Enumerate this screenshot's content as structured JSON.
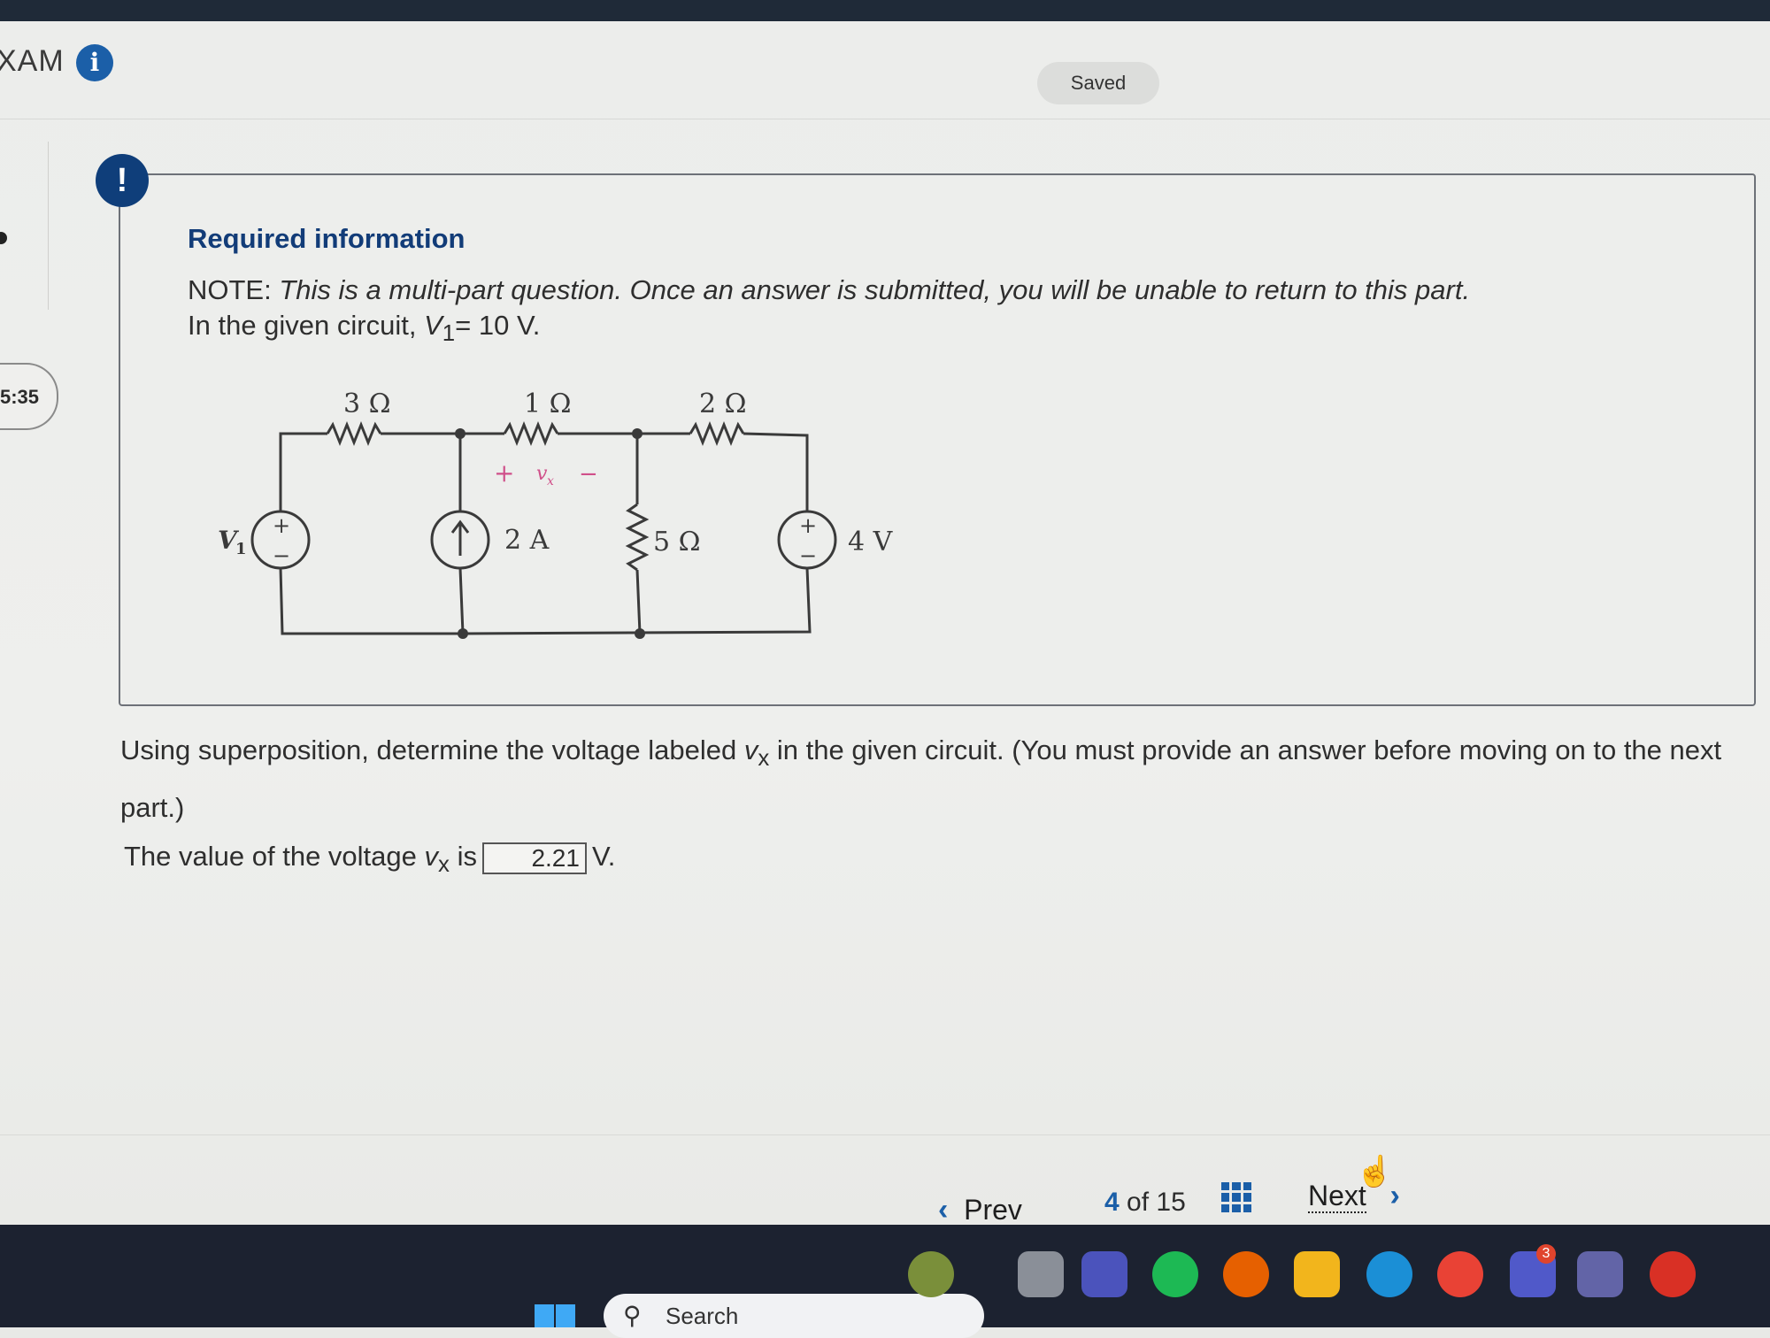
{
  "header": {
    "title": "XAM",
    "info_icon": "info-icon",
    "saved_label": "Saved"
  },
  "sidebar": {
    "timer": "5:35"
  },
  "required": {
    "title": "Required information",
    "note_prefix": "NOTE:",
    "note_italic": "This is a multi-part question. Once an answer is submitted, you will be unable to return to this part.",
    "given_prefix": "In the given circuit,",
    "given_var": "V",
    "given_sub": "1",
    "given_value": "= 10 V."
  },
  "circuit": {
    "r1": "3 Ω",
    "r2": "1 Ω",
    "r3": "2 Ω",
    "r4": "5 Ω",
    "i_source": "2 A",
    "v_source2": "4 V",
    "v_source1": "V",
    "v_source1_sub": "1",
    "vx_label": "v",
    "vx_sub": "x",
    "plus": "+",
    "minus": "−"
  },
  "question": {
    "text_a": "Using superposition, determine the voltage labeled",
    "var": "v",
    "var_sub": "x",
    "text_b": "in the given circuit. (You must provide an answer before moving on to the next part.)"
  },
  "answer": {
    "label_a": "The value of the voltage",
    "var": "v",
    "var_sub": "x",
    "label_b": "is",
    "value": "2.21",
    "unit": "V."
  },
  "nav": {
    "prev_label": "Prev",
    "current": "4",
    "of_label": "of 15",
    "next_label": "Next"
  },
  "taskbar": {
    "search_label": "Search",
    "badge_count": "3"
  },
  "colors": {
    "accent": "#1b5fa8",
    "title_blue": "#123c78",
    "alert": "#0f3e7a",
    "vx_marker": "#d0508a"
  }
}
